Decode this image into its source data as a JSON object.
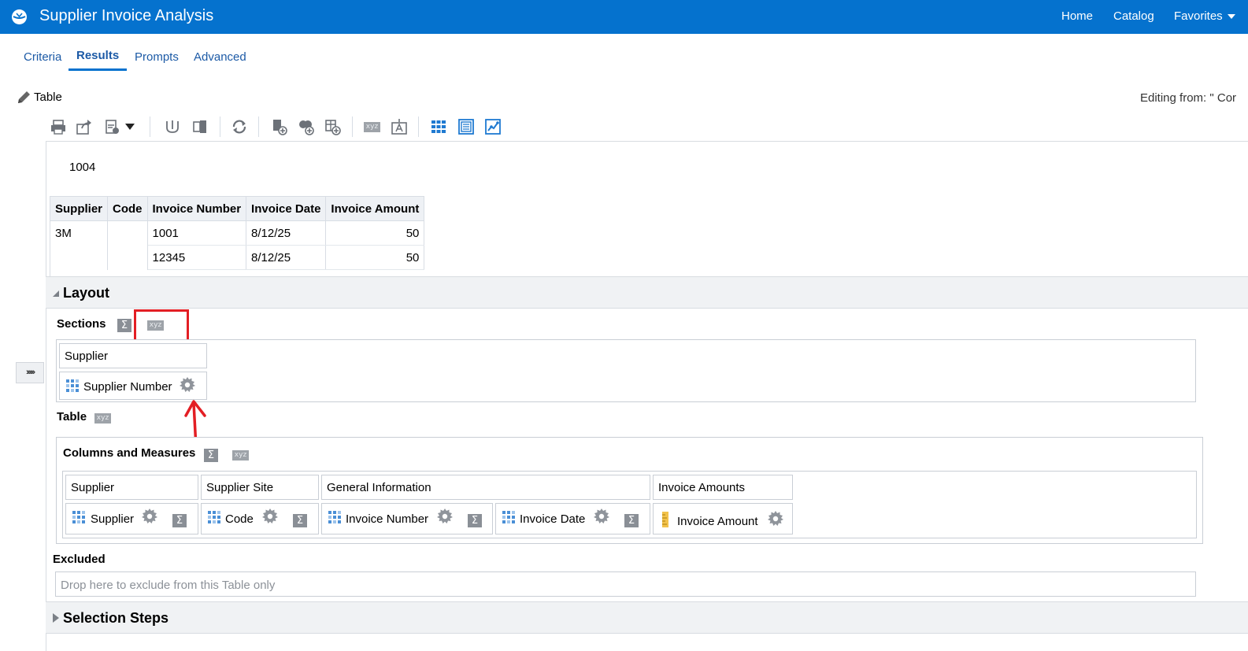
{
  "app": {
    "title": "Supplier Invoice Analysis"
  },
  "nav": {
    "home": "Home",
    "catalog": "Catalog",
    "favorites": "Favorites"
  },
  "tabs": [
    {
      "label": "Criteria"
    },
    {
      "label": "Results"
    },
    {
      "label": "Prompts"
    },
    {
      "label": "Advanced"
    }
  ],
  "view": {
    "name": "Table",
    "editing_from": "Editing from: \" Cor"
  },
  "section_value": "1004",
  "results_table": {
    "headers": [
      "Supplier",
      "Code",
      "Invoice Number",
      "Invoice Date",
      "Invoice Amount"
    ],
    "rows": [
      [
        "3M",
        "",
        "1001",
        "8/12/25",
        "50"
      ],
      [
        "",
        "",
        "12345",
        "8/12/25",
        "50"
      ]
    ]
  },
  "layout": {
    "title": "Layout",
    "sections_label": "Sections",
    "sections_group": "Supplier",
    "sections_item": "Supplier Number",
    "table_label": "Table",
    "columns_label": "Columns and Measures",
    "groups": [
      "Supplier",
      "Supplier Site",
      "General Information",
      "Invoice Amounts"
    ],
    "columns": [
      "Supplier",
      "Code",
      "Invoice Number",
      "Invoice Date",
      "Invoice Amount"
    ],
    "excluded_label": "Excluded",
    "excluded_placeholder": "Drop here to exclude from this Table only"
  },
  "selection_steps": {
    "title": "Selection Steps"
  },
  "icons": {
    "sigma": "Σ",
    "xyz": "xyz",
    "expander": "››››››"
  },
  "colors": {
    "brand": "#0572ce",
    "link": "#1c5aa6",
    "annotation": "#e31e24"
  }
}
